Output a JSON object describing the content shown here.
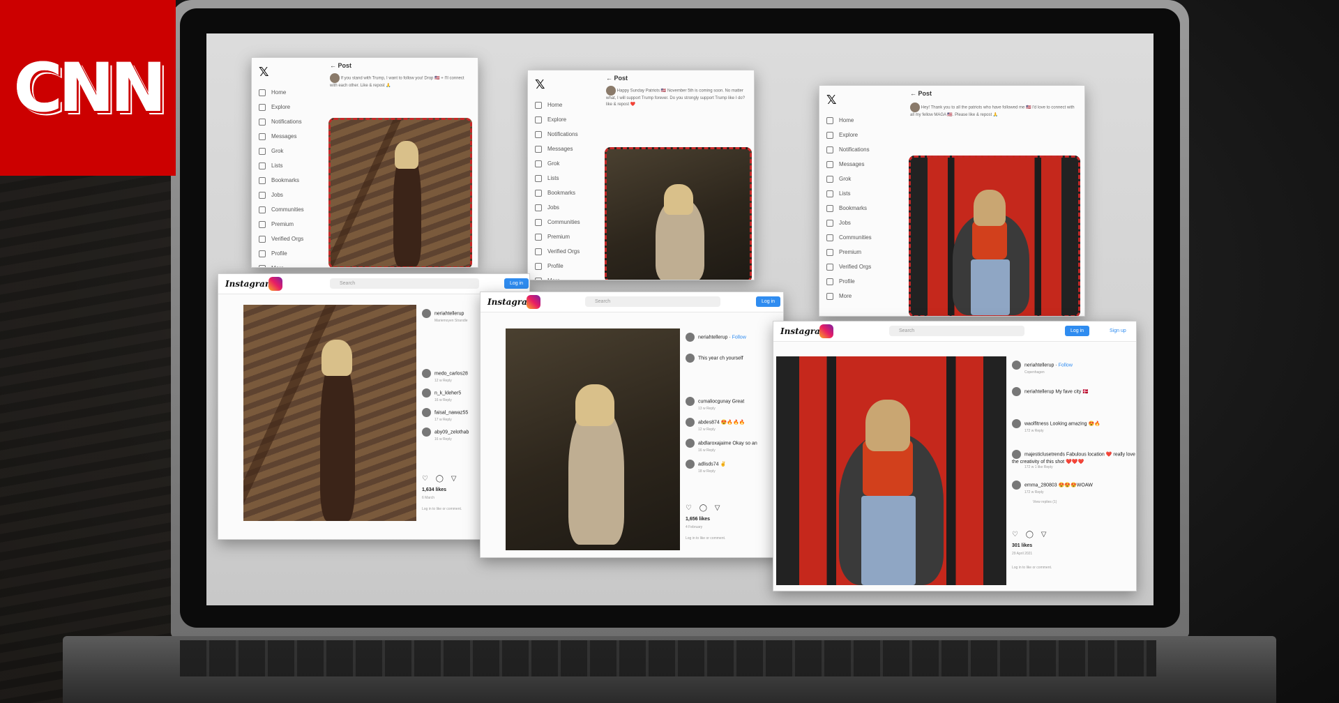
{
  "logo": {
    "text": "CNN"
  },
  "x_nav": [
    "Home",
    "Explore",
    "Notifications",
    "Messages",
    "Grok",
    "Lists",
    "Bookmarks",
    "Jobs",
    "Communities",
    "Premium",
    "Verified Orgs",
    "Profile",
    "More"
  ],
  "x_post_label": "Post",
  "x_posts": [
    {
      "text": "If you stand with Trump, I want to follow you! Drop 🇺🇸 + I'll connect with each other. Like & repost 🙏"
    },
    {
      "text": "Happy Sunday Patriots 🇺🇸 November 5th is coming soon. No matter what, I will support Trump forever. Do you strongly support Trump like I do? like & repost ❤️"
    },
    {
      "text": "Hey! Thank you to all the patriots who have followed me 🇺🇸 I'd love to connect with all my fellow MAGA 🇺🇸. Please like & repost 🙏"
    }
  ],
  "instagram": {
    "logo": "Instagram",
    "search": "Search",
    "login": "Log in",
    "signup": "Sign up",
    "login_prompt": "Log in to like or comment."
  },
  "ig_posts": [
    {
      "user": "neriahtellerup",
      "caption": "Mariemoyen Strandle",
      "comments": [
        {
          "user": "medo_carlos28",
          "time": "12 w  Reply"
        },
        {
          "user": "n_k_kleher5",
          "time": "16 w  Reply"
        },
        {
          "user": "faisal_nawaz55",
          "time": "17 w  Reply"
        },
        {
          "user": "aby09_zelothab",
          "time": "16 w  Reply"
        }
      ],
      "likes": "1,634 likes",
      "date": "6 March"
    },
    {
      "user": "neriahtellerup",
      "follow": "Follow",
      "caption": "This year ch yourself",
      "comments": [
        {
          "user": "cumaliocgunay Great",
          "time": "13 w  Reply"
        },
        {
          "user": "abdes874 😍🔥🔥🔥",
          "time": "12 w  Reply"
        },
        {
          "user": "abdlaroxajaime Okay so an",
          "time": "16 w  Reply"
        },
        {
          "user": "adlisds74 ✌️",
          "time": "18 w  Reply"
        }
      ],
      "likes": "1,656 likes",
      "date": "4 February"
    },
    {
      "user": "neriahtellerup",
      "follow": "Follow",
      "location": "Copenhagen",
      "caption": "neriahtellerup My fave city 🇩🇰",
      "comments": [
        {
          "user": "waolfitness Looking amazing 😍🔥",
          "time": "172 w  Reply"
        },
        {
          "user": "majesticlusetrends Fabulous location ❤️ really love the creativity of this shot ❤️❤️❤️",
          "time": "172 w  1 like  Reply"
        },
        {
          "user": "emma_280803 😍😍😍WOAW",
          "time": "172 w  Reply"
        }
      ],
      "view_replies": "View replies (1)",
      "likes": "301 likes",
      "date": "29 April 2021"
    }
  ]
}
